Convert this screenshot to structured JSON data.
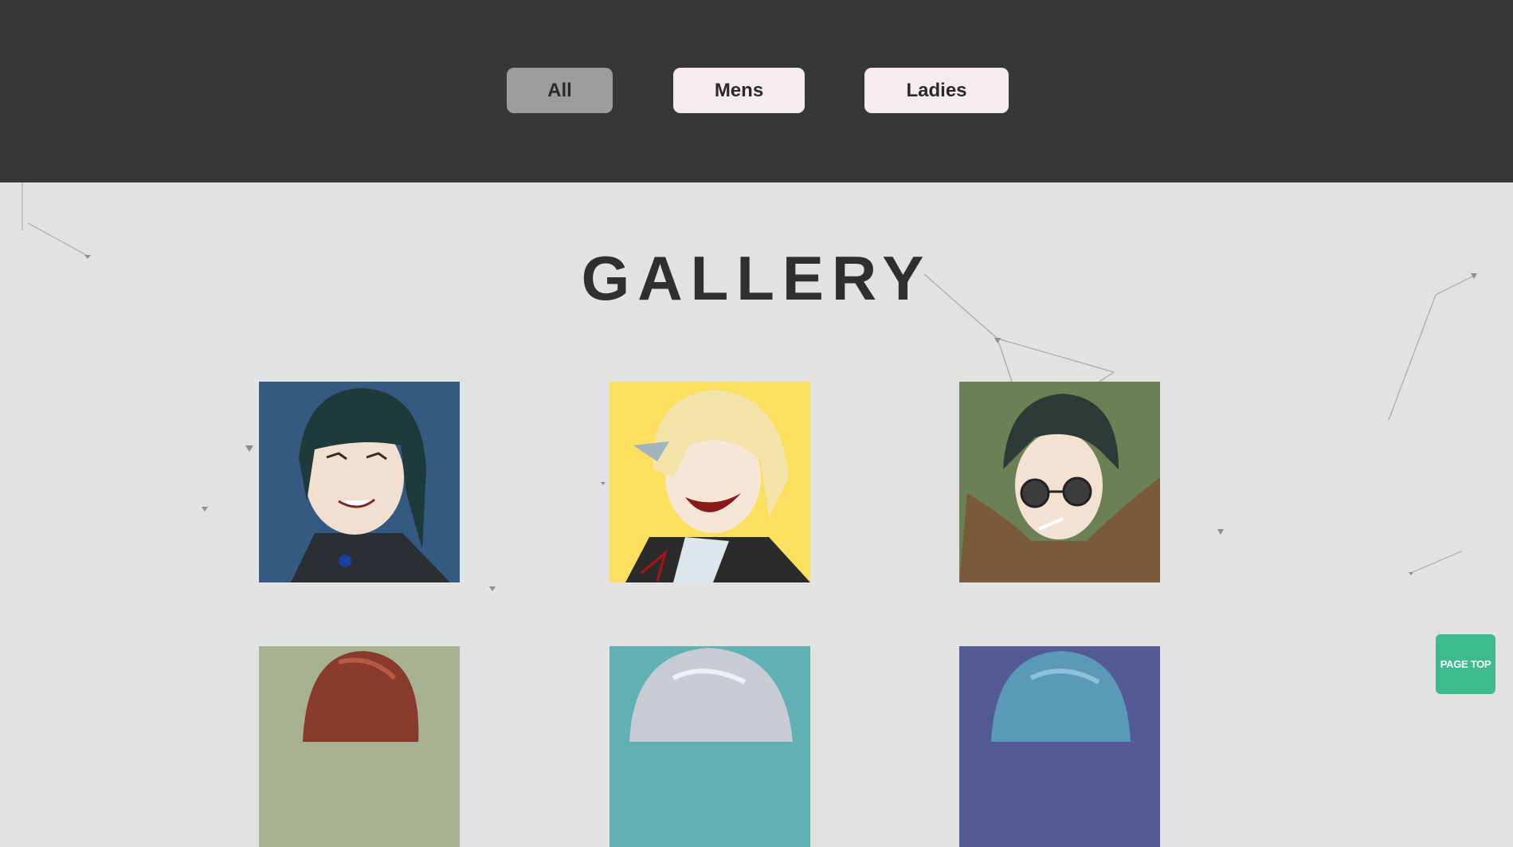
{
  "filters": {
    "all_label": "All",
    "mens_label": "Mens",
    "ladies_label": "Ladies",
    "active": "All"
  },
  "gallery": {
    "title": "GALLERY",
    "items": [
      {
        "name": "gallery-item-1",
        "bg_color": "#345a82",
        "hair_color": "#1f3a3a"
      },
      {
        "name": "gallery-item-2",
        "bg_color": "#fbe060",
        "hair_color": "#f3e3a8"
      },
      {
        "name": "gallery-item-3",
        "bg_color": "#6b8055",
        "hair_color": "#2d3a38"
      },
      {
        "name": "gallery-item-4",
        "bg_color": "#a6b192",
        "hair_color": "#8a3a2c"
      },
      {
        "name": "gallery-item-5",
        "bg_color": "#5fb1b4",
        "hair_color": "#c7ccd4"
      },
      {
        "name": "gallery-item-6",
        "bg_color": "#535a95",
        "hair_color": "#5a9ab8"
      }
    ]
  },
  "page_top": {
    "label": "PAGE TOP",
    "color": "#3dbb8d"
  },
  "colors": {
    "header_bg": "#373737",
    "page_bg": "#e2e2e2",
    "active_button": "#9c9c9c",
    "inactive_button": "#f4ecee"
  }
}
